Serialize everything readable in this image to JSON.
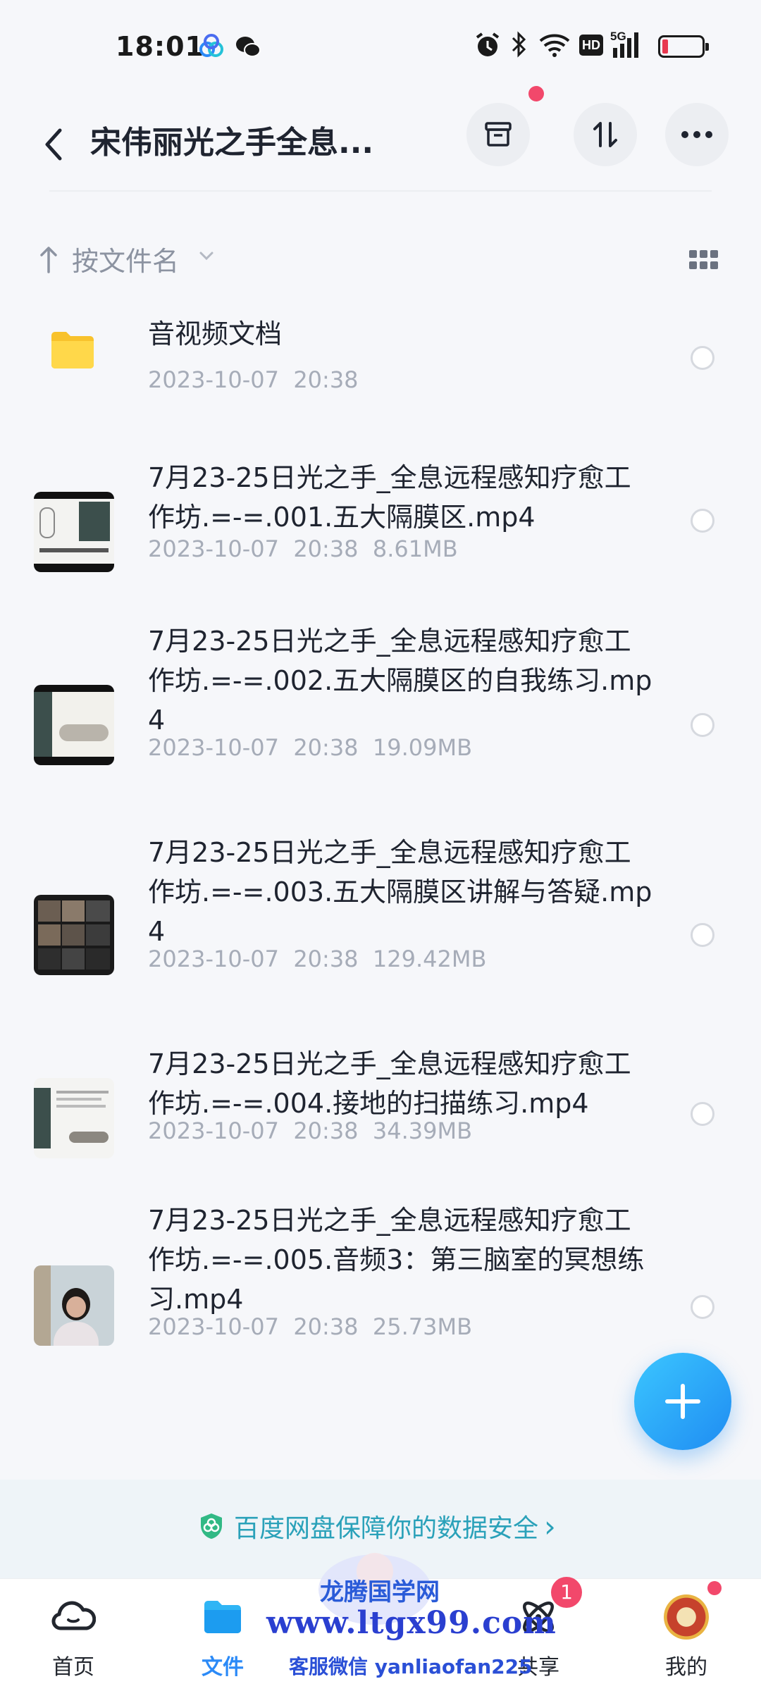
{
  "status_bar": {
    "time": "18:01",
    "icons": [
      "baidu-netdisk-app-icon",
      "wechat-app-icon",
      "alarm-icon",
      "bluetooth-icon",
      "wifi-icon",
      "hd-icon",
      "5g-signal-icon",
      "battery-low-icon"
    ],
    "hd_label": "HD",
    "network_label": "5G"
  },
  "header": {
    "title": "宋伟丽光之手全息...",
    "back_icon": "chevron-left-icon",
    "actions": [
      "archive-icon",
      "transfer-icon",
      "more-icon"
    ]
  },
  "sort": {
    "label": "按文件名",
    "view_toggle_icon": "grid-view-icon"
  },
  "files": [
    {
      "name": "音视频文档",
      "date": "2023-10-07  20:38",
      "size": "",
      "type": "folder"
    },
    {
      "name": "7月23-25日光之手_全息远程感知疗愈工作坊.=-=.001.五大隔膜区.mp4",
      "date": "2023-10-07  20:38",
      "size": "8.61MB",
      "type": "video"
    },
    {
      "name": "7月23-25日光之手_全息远程感知疗愈工作坊.=-=.002.五大隔膜区的自我练习.mp4",
      "date": "2023-10-07  20:38",
      "size": "19.09MB",
      "type": "video"
    },
    {
      "name": "7月23-25日光之手_全息远程感知疗愈工作坊.=-=.003.五大隔膜区讲解与答疑.mp4",
      "date": "2023-10-07  20:38",
      "size": "129.42MB",
      "type": "video"
    },
    {
      "name": "7月23-25日光之手_全息远程感知疗愈工作坊.=-=.004.接地的扫描练习.mp4",
      "date": "2023-10-07  20:38",
      "size": "34.39MB",
      "type": "video"
    },
    {
      "name": "7月23-25日光之手_全息远程感知疗愈工作坊.=-=.005.音频3：第三脑室的冥想练习.mp4",
      "date": "2023-10-07  20:38",
      "size": "25.73MB",
      "type": "video"
    }
  ],
  "banner": {
    "text": "百度网盘保障你的数据安全",
    "chevron": "›"
  },
  "bottom_nav": [
    {
      "label": "首页",
      "icon": "cloud-home-icon",
      "active": false
    },
    {
      "label": "文件",
      "icon": "folder-icon",
      "active": true
    },
    {
      "label": "",
      "icon": "",
      "active": false
    },
    {
      "label": "共享",
      "icon": "share-atom-icon",
      "active": false,
      "badge": "1"
    },
    {
      "label": "我的",
      "icon": "avatar-icon",
      "active": false
    }
  ],
  "watermark": {
    "title": "龙腾国学网",
    "url": "www.ltgx99.com",
    "wechat": "客服微信 yanliaofan225"
  },
  "colors": {
    "accent": "#2b8af7",
    "badge": "#f2486b",
    "meta_text": "#a6acb8",
    "banner_text": "#2aa1b9"
  }
}
